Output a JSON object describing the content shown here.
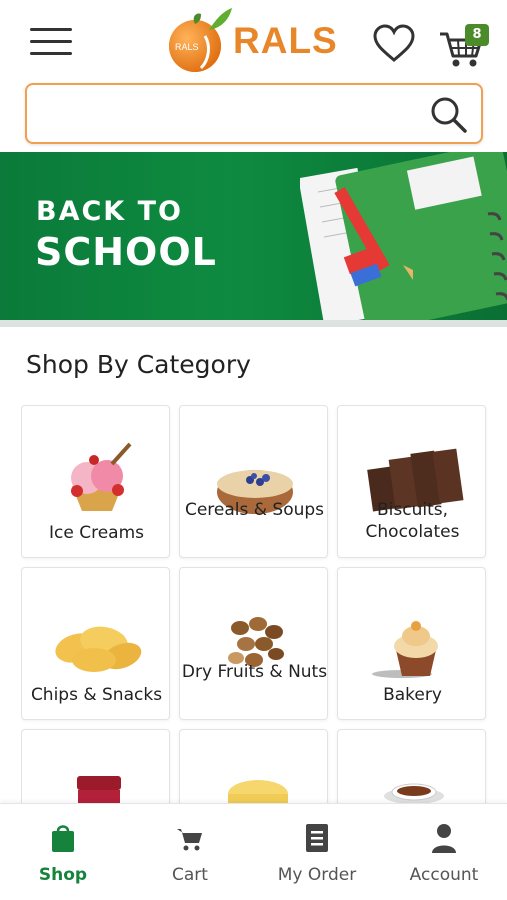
{
  "header": {
    "logo_text": "RALS",
    "logo_badge_text": "RALS",
    "cart_count": "8",
    "brand_color": "#e8872a",
    "badge_color": "#4b8b2a"
  },
  "search": {
    "value": "",
    "placeholder": ""
  },
  "banner": {
    "line1": "BACK TO",
    "line2": "SCHOOL",
    "background": "#0e8b40"
  },
  "section": {
    "title": "Shop By Category"
  },
  "categories": [
    {
      "label": "Ice Creams",
      "icon": "ice-cream-icon"
    },
    {
      "label": "Cereals & Soups",
      "icon": "cereal-bowl-icon"
    },
    {
      "label": "Biscuits, Chocolates",
      "icon": "chocolate-icon"
    },
    {
      "label": "Chips & Snacks",
      "icon": "chips-icon"
    },
    {
      "label": "Dry Fruits & Nuts",
      "icon": "nuts-icon"
    },
    {
      "label": "Bakery",
      "icon": "cupcake-icon"
    },
    {
      "label": "",
      "icon": "jam-jar-icon"
    },
    {
      "label": "",
      "icon": "butter-icon"
    },
    {
      "label": "",
      "icon": "tea-cup-icon"
    }
  ],
  "nav": {
    "items": [
      {
        "label": "Shop",
        "icon": "shopping-bag-icon",
        "active": true
      },
      {
        "label": "Cart",
        "icon": "cart-icon",
        "active": false
      },
      {
        "label": "My Order",
        "icon": "order-list-icon",
        "active": false
      },
      {
        "label": "Account",
        "icon": "person-icon",
        "active": false
      }
    ],
    "active_color": "#17823c"
  }
}
